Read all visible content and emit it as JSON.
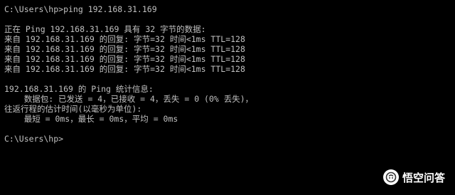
{
  "console": {
    "lines": [
      "C:\\Users\\hp>ping 192.168.31.169",
      "",
      "正在 Ping 192.168.31.169 具有 32 字节的数据:",
      "来自 192.168.31.169 的回复: 字节=32 时间<1ms TTL=128",
      "来自 192.168.31.169 的回复: 字节=32 时间<1ms TTL=128",
      "来自 192.168.31.169 的回复: 字节=32 时间<1ms TTL=128",
      "来自 192.168.31.169 的回复: 字节=32 时间<1ms TTL=128",
      "",
      "192.168.31.169 的 Ping 统计信息:",
      "    数据包: 已发送 = 4，已接收 = 4，丢失 = 0 (0% 丢失)，",
      "往返行程的估计时间(以毫秒为单位):",
      "    最短 = 0ms，最长 = 0ms，平均 = 0ms",
      "",
      "C:\\Users\\hp>"
    ]
  },
  "watermark": {
    "text": "悟空问答",
    "icon": "wukong-logo-icon"
  },
  "colors": {
    "background": "#000000",
    "text": "#c0c0c0"
  }
}
